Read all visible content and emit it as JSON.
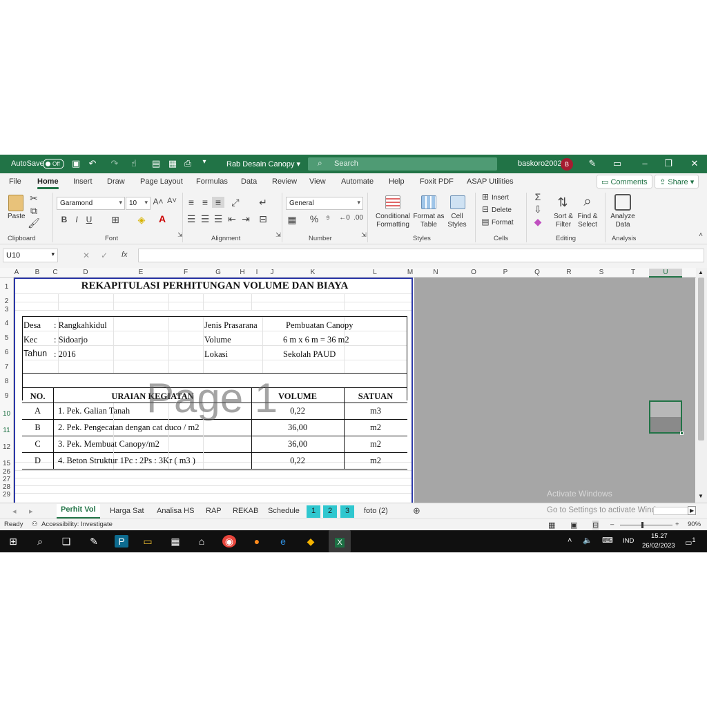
{
  "titlebar": {
    "autosave_label": "AutoSave",
    "autosave_state": "Off",
    "filename": "Rab Desain Canopy",
    "search_placeholder": "Search",
    "user": "baskoro2002",
    "avatar_initial": "B"
  },
  "menu": {
    "items": [
      "File",
      "Home",
      "Insert",
      "Draw",
      "Page Layout",
      "Formulas",
      "Data",
      "Review",
      "View",
      "Automate",
      "Help",
      "Foxit PDF",
      "ASAP Utilities"
    ],
    "active": "Home",
    "comments": "Comments",
    "share": "Share"
  },
  "ribbon": {
    "clipboard": {
      "paste": "Paste",
      "label": "Clipboard"
    },
    "font": {
      "name": "Garamond",
      "size": "10",
      "label": "Font",
      "bold": "B",
      "italic": "I",
      "underline": "U"
    },
    "alignment": {
      "label": "Alignment"
    },
    "number": {
      "format": "General",
      "label": "Number",
      "percent": "%"
    },
    "styles": {
      "conditional": "Conditional Formatting",
      "format_table": "Format as Table",
      "cell_styles": "Cell Styles",
      "label": "Styles"
    },
    "cells": {
      "insert": "Insert",
      "delete": "Delete",
      "format": "Format",
      "label": "Cells"
    },
    "editing": {
      "sort": "Sort & Filter",
      "find": "Find & Select",
      "label": "Editing"
    },
    "analysis": {
      "analyze": "Analyze Data",
      "label": "Analysis"
    }
  },
  "formula_bar": {
    "name_box": "U10",
    "fx": "fx",
    "content": ""
  },
  "columns": [
    "A",
    "B",
    "C",
    "D",
    "E",
    "F",
    "G",
    "H",
    "I",
    "J",
    "K",
    "L",
    "M",
    "N",
    "O",
    "P",
    "Q",
    "R",
    "S",
    "T",
    "U"
  ],
  "rows": [
    "1",
    "2",
    "3",
    "4",
    "5",
    "6",
    "7",
    "8",
    "9",
    "10",
    "11",
    "12",
    "15",
    "26",
    "27",
    "28",
    "29"
  ],
  "sheet": {
    "title": "REKAPITULASI PERHITUNGAN VOLUME DAN BIAYA",
    "info": [
      {
        "label": "Desa",
        "value": ": Rangkahkidul",
        "label2": "Jenis Prasarana",
        "value2": "Pembuatan Canopy"
      },
      {
        "label": "Kec",
        "value": ": Sidoarjo",
        "label2": "Volume",
        "value2": "6 m x 6 m = 36 m2"
      },
      {
        "label": "Tahun",
        "value": ": 2016",
        "label2": "Lokasi",
        "value2": "Sekolah PAUD"
      }
    ],
    "headers": {
      "no": "NO.",
      "uraian": "URAIAN KEGIATAN",
      "volume": "VOLUME",
      "satuan": "SATUAN"
    },
    "items": [
      {
        "no": "A",
        "uraian": "1. Pek. Galian Tanah",
        "volume": "0,22",
        "satuan": "m3"
      },
      {
        "no": "B",
        "uraian": "2. Pek. Pengecatan dengan cat duco / m2",
        "volume": "36,00",
        "satuan": "m2"
      },
      {
        "no": "C",
        "uraian": "3. Pek. Membuat Canopy/m2",
        "volume": "36,00",
        "satuan": "m2"
      },
      {
        "no": "D",
        "uraian": "4. Beton Struktur 1Pc : 2Ps : 3Kr ( m3 )",
        "volume": "0,22",
        "satuan": "m2"
      }
    ],
    "watermark": "Page 1"
  },
  "tabs": [
    "Perhit Vol",
    "Harga Sat",
    "Analisa HS",
    "RAP",
    "REKAB",
    "Schedule",
    "1",
    "2",
    "3",
    "foto (2)"
  ],
  "active_tab": "Perhit Vol",
  "activation": {
    "line1": "Activate Windows",
    "line2": "Go to Settings to activate Windows."
  },
  "status": {
    "ready": "Ready",
    "accessibility": "Accessibility: Investigate",
    "zoom": "90%"
  },
  "taskbar": {
    "lang": "IND",
    "time": "15.27",
    "date": "26/02/2023",
    "notif": "1"
  },
  "colors": {
    "excel_green": "#217346",
    "selection_border": "#2b37a8",
    "teal_tab": "#2fc7cf",
    "avatar": "#a51c30"
  }
}
